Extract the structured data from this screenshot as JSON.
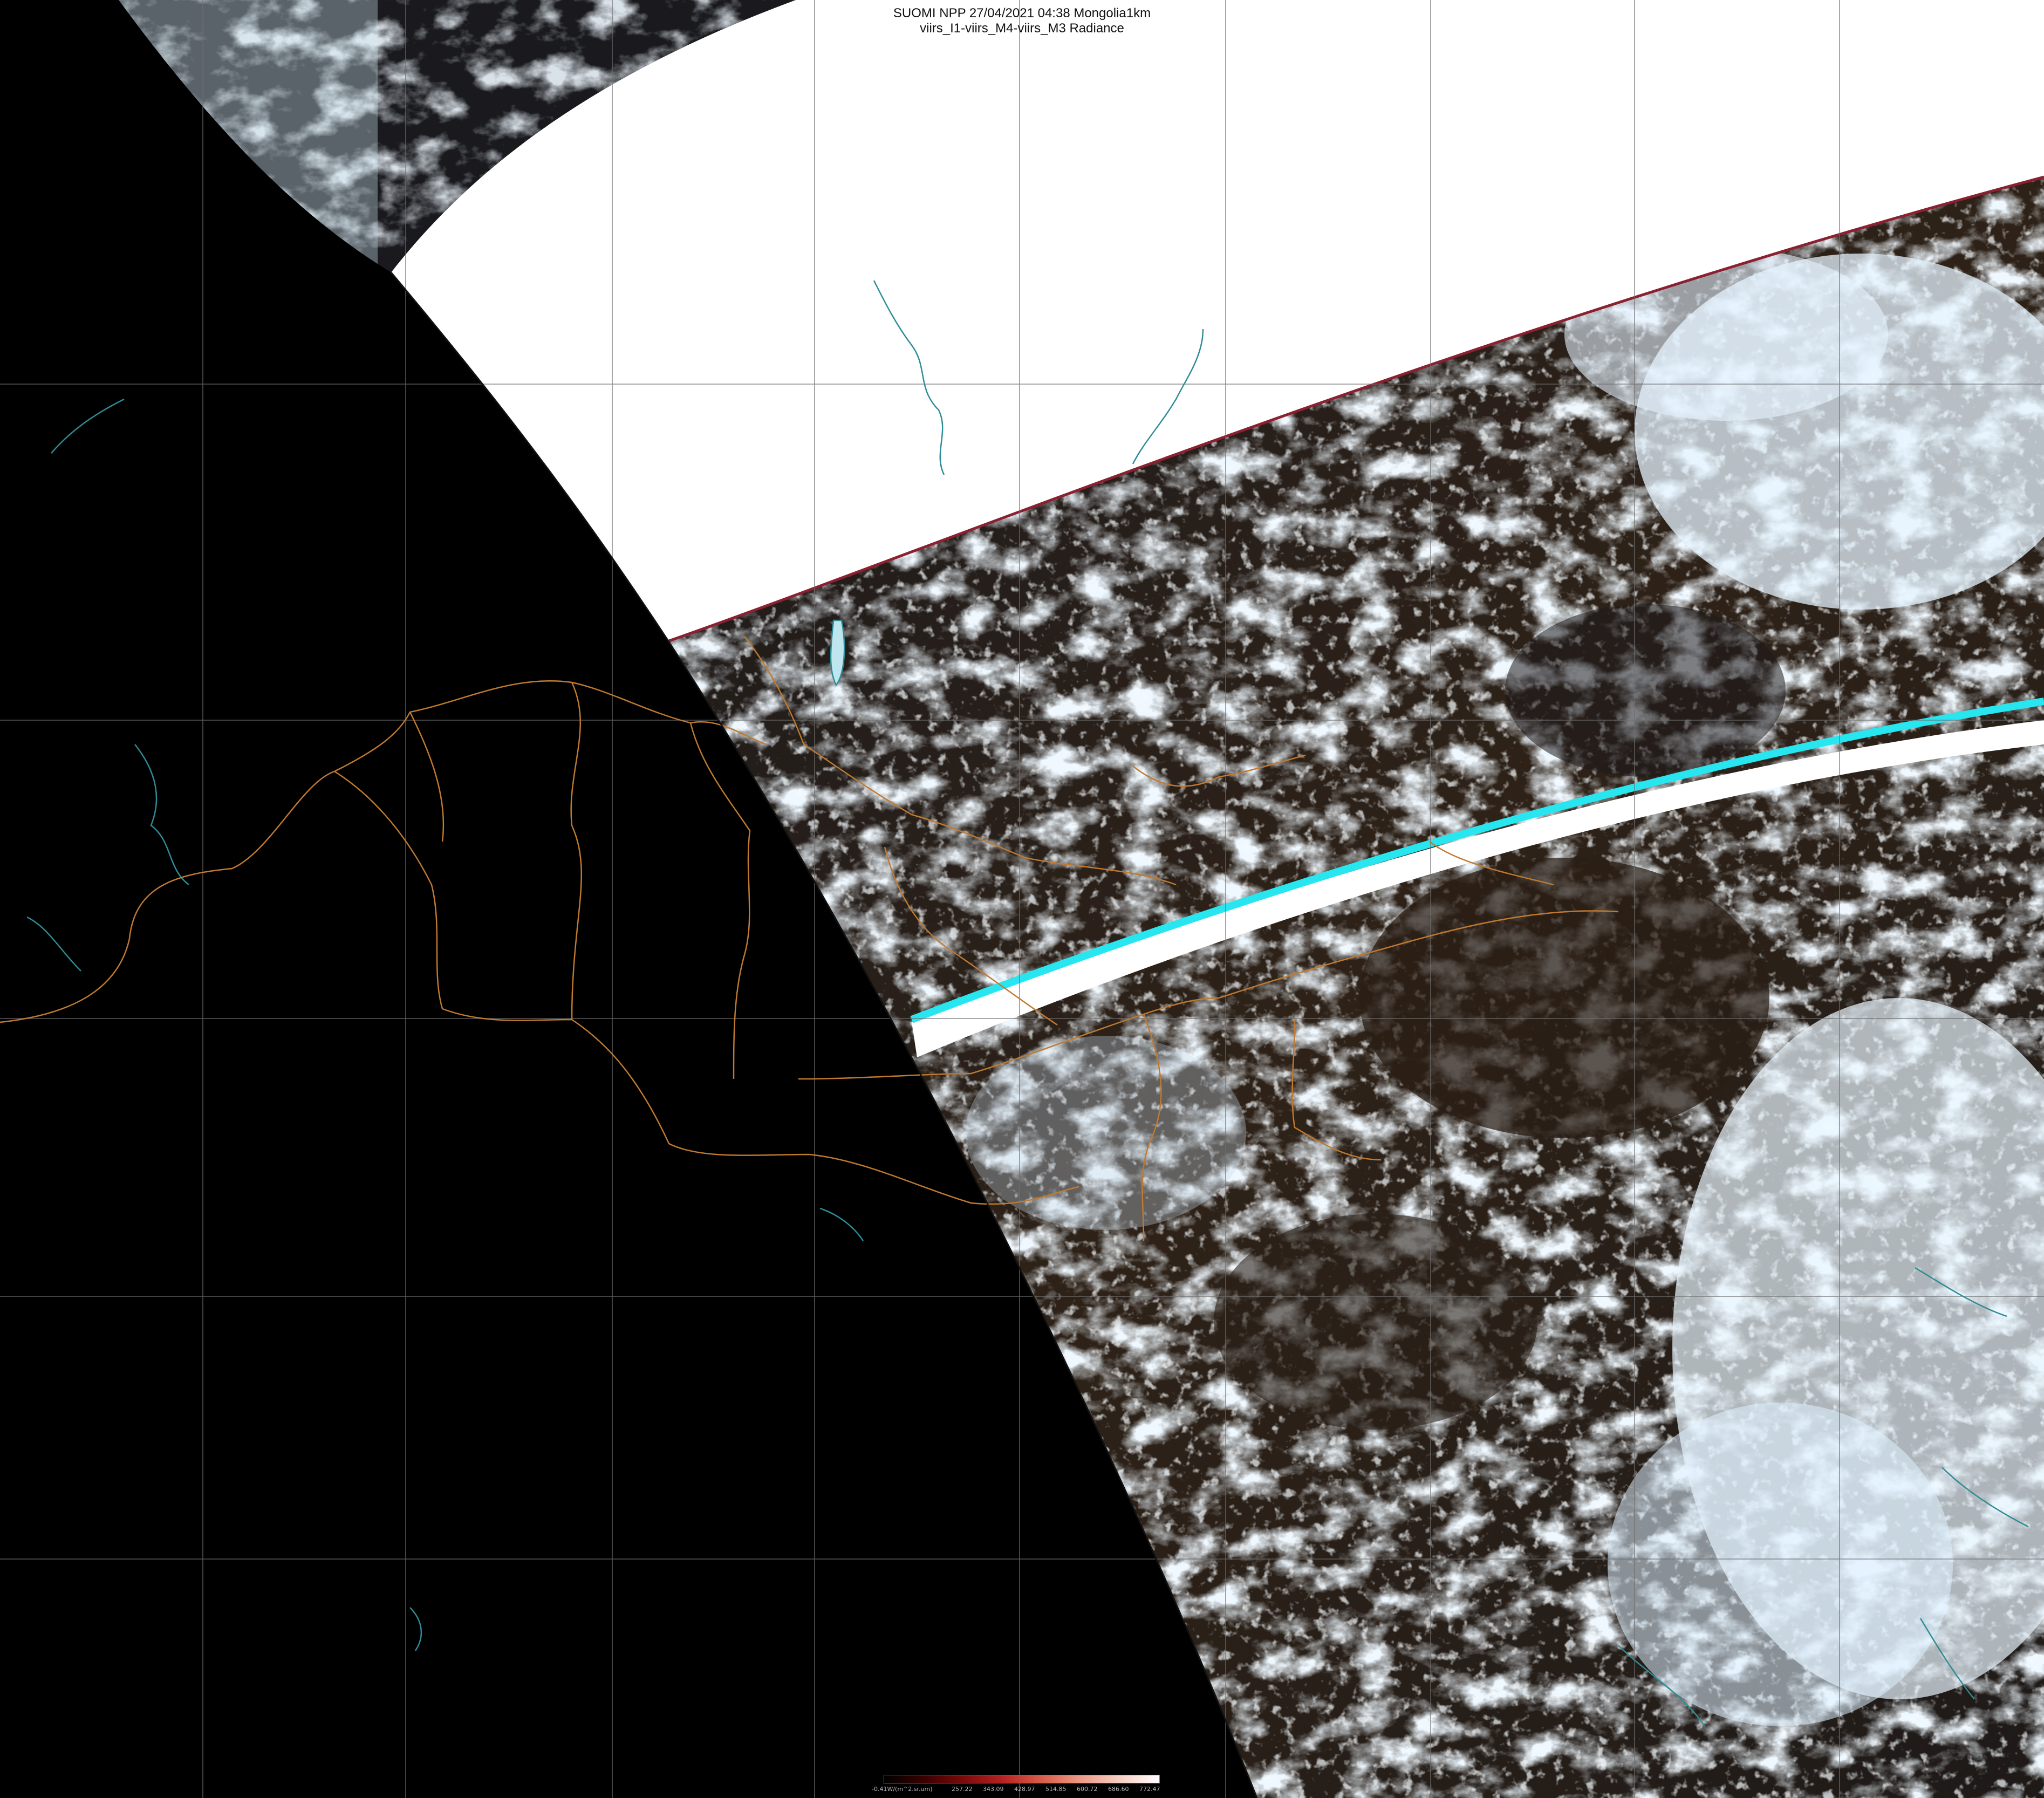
{
  "title": {
    "line1": "SUOMI NPP 27/04/2021 04:38 Mongolia1km",
    "line2": "viirs_I1-viirs_M4-viirs_M3 Radiance"
  },
  "legend": {
    "ticks": [
      "-0.41W/(m^2.sr.um)",
      "257.22",
      "343.09",
      "428.97",
      "514.85",
      "600.72",
      "686.60",
      "772.47"
    ],
    "colors": [
      "#000000",
      "#3a0000",
      "#7a0a0a",
      "#b52222",
      "#d85c4a",
      "#ec9a86",
      "#f7cfc4",
      "#ffffff"
    ]
  },
  "colors": {
    "space": "#000000",
    "no_data": "#ffffff",
    "land": "#2a2018",
    "cloud": "#d8eefa",
    "border": "#c07a30",
    "coast": "#2e8c96",
    "scan_gap": "#27e6f0",
    "grid": "#6f6f6f"
  }
}
